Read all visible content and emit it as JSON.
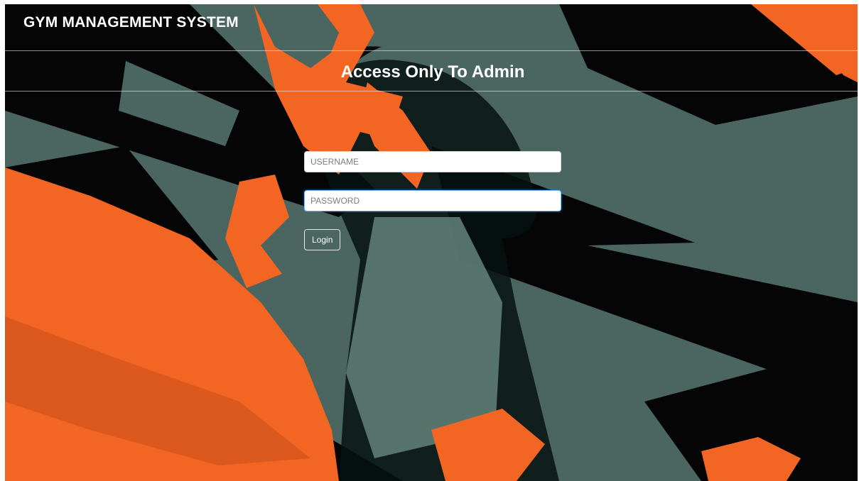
{
  "header": {
    "brand": "GYM MANAGEMENT SYSTEM",
    "heading": "Access Only To Admin"
  },
  "login": {
    "username_placeholder": "USERNAME",
    "password_placeholder": "PASSWORD",
    "submit_label": "Login"
  },
  "colors": {
    "background": "#4b6560",
    "accent_orange": "#f26522",
    "shadow_black": "#050505",
    "text": "#ffffff"
  }
}
